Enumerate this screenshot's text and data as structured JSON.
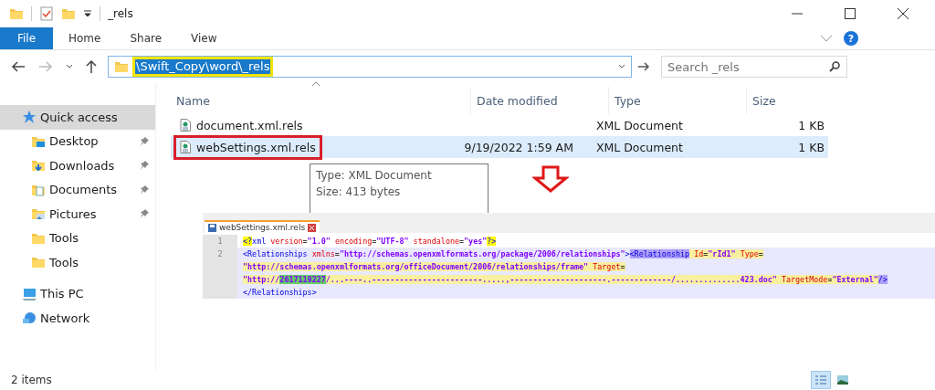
{
  "window": {
    "title": "_rels"
  },
  "ribbon": {
    "tabs": [
      {
        "label": "File",
        "kind": "file"
      },
      {
        "label": "Home",
        "kind": "tab"
      },
      {
        "label": "Share",
        "kind": "tab"
      },
      {
        "label": "View",
        "kind": "tab"
      }
    ],
    "help": "?"
  },
  "address": {
    "path": "\\Swift_Copy\\word\\_rels",
    "outlined": true,
    "search_placeholder": "Search _rels"
  },
  "sidebar": {
    "items": [
      {
        "label": "Quick access",
        "kind": "star",
        "selected": true,
        "children": [
          {
            "label": "Desktop",
            "kind": "desktop",
            "pinned": true,
            "selected": false
          },
          {
            "label": "Downloads",
            "kind": "downloads",
            "pinned": true,
            "selected": false
          },
          {
            "label": "Documents",
            "kind": "documents",
            "pinned": true,
            "selected": false
          },
          {
            "label": "Pictures",
            "kind": "pictures",
            "pinned": true,
            "selected": false
          },
          {
            "label": "Tools",
            "kind": "folder",
            "pinned": false,
            "selected": false
          },
          {
            "label": "Tools",
            "kind": "folder",
            "pinned": false,
            "selected": false
          }
        ]
      },
      {
        "label": "This PC",
        "kind": "pc",
        "selected": false
      },
      {
        "label": "Network",
        "kind": "network",
        "selected": false
      }
    ]
  },
  "table": {
    "columns": [
      "Name",
      "Date modified",
      "Type",
      "Size"
    ],
    "rows": [
      {
        "name": "document.xml.rels",
        "date": "",
        "type": "XML Document",
        "size": "1 KB",
        "selected": false,
        "outlined": false
      },
      {
        "name": "webSettings.xml.rels",
        "date": "9/19/2022 1:59 AM",
        "type": "XML Document",
        "size": "1 KB",
        "selected": true,
        "outlined": true
      }
    ]
  },
  "tooltip": {
    "lines": [
      "Type: XML Document",
      "Size: 413 bytes"
    ]
  },
  "editor": {
    "tab": "webSettings.xml.rels",
    "rows": [
      {
        "number": "1",
        "current": false,
        "segments": [
          {
            "kind": "tag",
            "text": "<?",
            "color": "#ffff00"
          },
          {
            "kind": "tag",
            "text": "xml "
          },
          {
            "kind": "attr",
            "text": "version"
          },
          {
            "kind": "text",
            "text": "="
          },
          {
            "kind": "value",
            "text": "\"1.0\" "
          },
          {
            "kind": "attr",
            "text": "encoding"
          },
          {
            "kind": "text",
            "text": "="
          },
          {
            "kind": "value",
            "text": "\"UTF-8\" "
          },
          {
            "kind": "attr",
            "text": "standalone"
          },
          {
            "kind": "text",
            "text": "="
          },
          {
            "kind": "value",
            "text": "\"yes\""
          },
          {
            "kind": "tag",
            "text": "?>",
            "color": "#ffff00"
          }
        ]
      },
      {
        "number": "2",
        "current": true,
        "segments": [
          {
            "kind": "tag",
            "text": "<Relationships "
          },
          {
            "kind": "attr",
            "text": "xmlns"
          },
          {
            "kind": "text",
            "text": "="
          },
          {
            "kind": "value",
            "text": "\"http://schemas.openxmlformats.org/package/2006/relationships\""
          },
          {
            "kind": "tag",
            "text": ">"
          },
          {
            "kind": "tag",
            "text": "<Relationship",
            "color": "#b0a0f8"
          },
          {
            "kind": "attr",
            "text": " Id",
            "color": "#f8f0a0"
          },
          {
            "kind": "text",
            "text": "=",
            "color": "#f8f0a0"
          },
          {
            "kind": "value",
            "text": "\"rId1\" ",
            "color": "#f8f0a0"
          },
          {
            "kind": "attr",
            "text": "Type",
            "color": "#f8f0a0"
          },
          {
            "kind": "text",
            "text": "=",
            "color": "#f8f0a0"
          }
        ]
      },
      {
        "current": true,
        "segments": [
          {
            "kind": "value",
            "text": "\"http://schemas.openxmlformats.org/officeDocument/2006/relationships/frame\" ",
            "color": "#f8f0a0"
          },
          {
            "kind": "attr",
            "text": "Target",
            "color": "#f8f0a0"
          },
          {
            "kind": "text",
            "text": "=",
            "color": "#f8f0a0"
          }
        ]
      },
      {
        "current": true,
        "segments": [
          {
            "kind": "value",
            "text": "\"http://",
            "color": "#f8f0a0"
          },
          {
            "kind": "value",
            "text": "2617119227",
            "color": "#66cc66"
          },
          {
            "kind": "value",
            "text": "/...----..------------------------.....,---------------------.-------------/..............423.doc\" ",
            "color": "#f8f0a0"
          },
          {
            "kind": "attr",
            "text": "TargetMode",
            "color": "#f8f0a0"
          },
          {
            "kind": "text",
            "text": "=",
            "color": "#f8f0a0"
          },
          {
            "kind": "value",
            "text": "\"External\"",
            "color": "#f8f0a0"
          },
          {
            "kind": "tag",
            "text": "/>",
            "color": "#b0a0f8"
          }
        ]
      },
      {
        "current": true,
        "segments": [
          {
            "kind": "tag",
            "text": "</Relationships>"
          }
        ]
      }
    ]
  },
  "status_bar": {
    "count": "2 items",
    "views": [
      {
        "kind": "details",
        "selected": true
      },
      {
        "kind": "large",
        "selected": false
      }
    ]
  }
}
